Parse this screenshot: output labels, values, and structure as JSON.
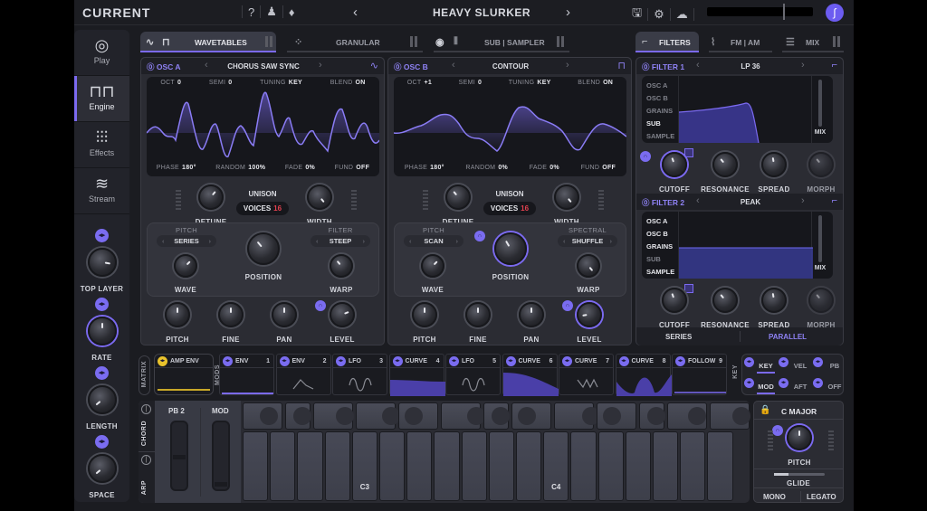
{
  "app": {
    "logo": "CURRENT"
  },
  "topbar": {
    "help_icon": "?",
    "user_icon": "user-icon",
    "bell_icon": "bell-icon",
    "prev": "‹",
    "next": "›",
    "preset_name": "HEAVY SLURKER",
    "save_icon": "save-icon",
    "settings_icon": "gear-icon",
    "cloud_icon": "cloud-icon",
    "avatar_glyph": "∫"
  },
  "sidebar": {
    "items": [
      {
        "label": "Play",
        "icon": "◎"
      },
      {
        "label": "Engine",
        "icon": "⊓⊓"
      },
      {
        "label": "Effects",
        "icon": "⫶⫶⫶"
      },
      {
        "label": "Stream",
        "icon": "≋"
      }
    ],
    "macros": [
      {
        "label": "TOP LAYER",
        "value": 0.78
      },
      {
        "label": "RATE",
        "value": 0.55
      },
      {
        "label": "LENGTH",
        "value": 0.2
      },
      {
        "label": "SPACE",
        "value": 0.15
      }
    ]
  },
  "tabs": {
    "wavetables": "WAVETABLES",
    "granular": "GRANULAR",
    "sub_sampler": "SUB | SAMPLER",
    "filters": "FILTERS",
    "fm_am": "FM | AM",
    "mix": "MIX"
  },
  "osc_a": {
    "name": "OSC A",
    "preset": "CHORUS SAW SYNC",
    "params_top": [
      {
        "label": "OCT",
        "value": "0"
      },
      {
        "label": "SEMI",
        "value": "0"
      },
      {
        "label": "TUNING",
        "value": "KEY"
      },
      {
        "label": "BLEND",
        "value": "ON"
      }
    ],
    "params_bottom": [
      {
        "label": "PHASE",
        "value": "180°"
      },
      {
        "label": "RANDOM",
        "value": "100%"
      },
      {
        "label": "FADE",
        "value": "0%"
      },
      {
        "label": "FUND",
        "value": "OFF"
      }
    ],
    "unison": "UNISON",
    "voices_label": "VOICES",
    "voices": "16",
    "detune": "DETUNE",
    "width": "WIDTH",
    "pitch_label": "PITCH",
    "pitch_mode": "SERIES",
    "filter_label": "FILTER",
    "filter_mode": "STEEP",
    "wave": "WAVE",
    "position": "POSITION",
    "warp": "WARP",
    "k_pitch": "PITCH",
    "k_fine": "FINE",
    "k_pan": "PAN",
    "k_level": "LEVEL"
  },
  "osc_b": {
    "name": "OSC B",
    "preset": "CONTOUR",
    "params_top": [
      {
        "label": "OCT",
        "value": "+1"
      },
      {
        "label": "SEMI",
        "value": "0"
      },
      {
        "label": "TUNING",
        "value": "KEY"
      },
      {
        "label": "BLEND",
        "value": "ON"
      }
    ],
    "params_bottom": [
      {
        "label": "PHASE",
        "value": "180°"
      },
      {
        "label": "RANDOM",
        "value": "0%"
      },
      {
        "label": "FADE",
        "value": "0%"
      },
      {
        "label": "FUND",
        "value": "OFF"
      }
    ],
    "unison": "UNISON",
    "voices_label": "VOICES",
    "voices": "16",
    "detune": "DETUNE",
    "width": "WIDTH",
    "pitch_label": "PITCH",
    "pitch_mode": "SCAN",
    "filter_label": "SPECTRAL",
    "filter_mode": "SHUFFLE",
    "wave": "WAVE",
    "position": "POSITION",
    "warp": "WARP",
    "k_pitch": "PITCH",
    "k_fine": "FINE",
    "k_pan": "PAN",
    "k_level": "LEVEL"
  },
  "filter1": {
    "name": "FILTER 1",
    "type": "LP 36",
    "sources": [
      {
        "label": "OSC A",
        "on": false
      },
      {
        "label": "OSC B",
        "on": false
      },
      {
        "label": "GRAINS",
        "on": false
      },
      {
        "label": "SUB",
        "on": true
      },
      {
        "label": "SAMPLE",
        "on": false
      }
    ],
    "mix": "MIX",
    "knobs": [
      "CUTOFF",
      "RESONANCE",
      "SPREAD",
      "MORPH"
    ]
  },
  "filter2": {
    "name": "FILTER 2",
    "type": "PEAK",
    "sources": [
      {
        "label": "OSC A",
        "on": true
      },
      {
        "label": "OSC B",
        "on": true
      },
      {
        "label": "GRAINS",
        "on": true
      },
      {
        "label": "SUB",
        "on": false
      },
      {
        "label": "SAMPLE",
        "on": true
      }
    ],
    "mix": "MIX",
    "knobs": [
      "CUTOFF",
      "RESONANCE",
      "SPREAD",
      "MORPH"
    ]
  },
  "routing": {
    "series": "SERIES",
    "parallel": "PARALLEL"
  },
  "mods": {
    "matrix": "MATRIX",
    "mods_label": "MODS",
    "amp_env": "AMP ENV",
    "slots": [
      {
        "name": "ENV",
        "num": "1"
      },
      {
        "name": "ENV",
        "num": "2"
      },
      {
        "name": "LFO",
        "num": "3"
      },
      {
        "name": "CURVE",
        "num": "4"
      },
      {
        "name": "LFO",
        "num": "5"
      },
      {
        "name": "CURVE",
        "num": "6"
      },
      {
        "name": "CURVE",
        "num": "7"
      },
      {
        "name": "CURVE",
        "num": "8"
      },
      {
        "name": "FOLLOW",
        "num": "9"
      }
    ],
    "key_label": "KEY",
    "key_sources": [
      "KEY",
      "VEL",
      "PB",
      "MOD",
      "AFT",
      "OFF"
    ]
  },
  "keyboard": {
    "chord": "CHORD",
    "arp": "ARP",
    "pb_label": "PB",
    "pb_value": "2",
    "mod_label": "MOD",
    "c3": "C3",
    "c4": "C4"
  },
  "scale": {
    "name": "C MAJOR",
    "pitch": "PITCH",
    "glide": "GLIDE",
    "mono": "MONO",
    "legato": "LEGATO"
  }
}
